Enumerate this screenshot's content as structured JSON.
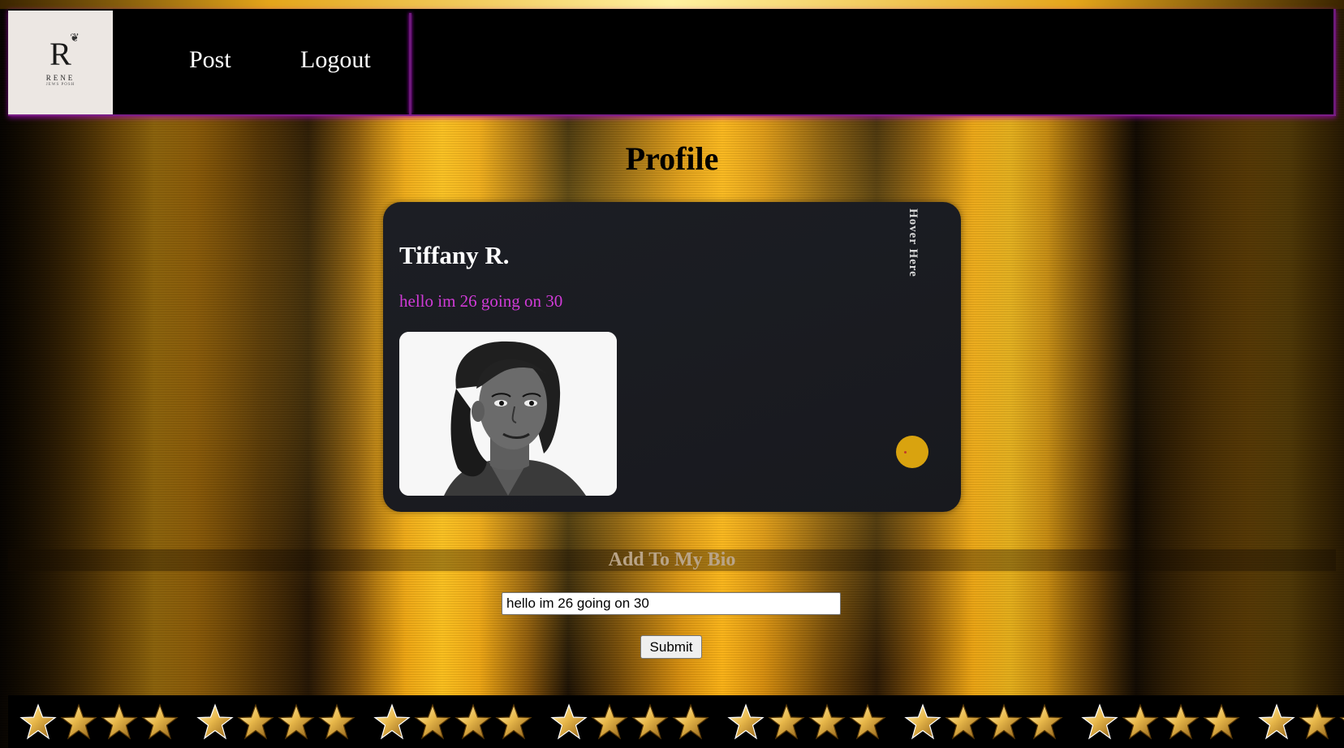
{
  "logo": {
    "mark": "R",
    "name": "RENE",
    "tagline": "JEWS POSH"
  },
  "nav": {
    "post_label": "Post",
    "logout_label": "Logout"
  },
  "page": {
    "title": "Profile"
  },
  "profile_card": {
    "name": "Tiffany R.",
    "bio": "hello im 26 going on 30",
    "hover_label": "Hover Here"
  },
  "bio_form": {
    "heading": "Add To My Bio",
    "input_value": "hello im 26 going on 30",
    "submit_label": "Submit"
  },
  "colors": {
    "bio_text": "#d13bd8",
    "nav_accent": "#7a1e86",
    "dot": "#d9a30f"
  }
}
